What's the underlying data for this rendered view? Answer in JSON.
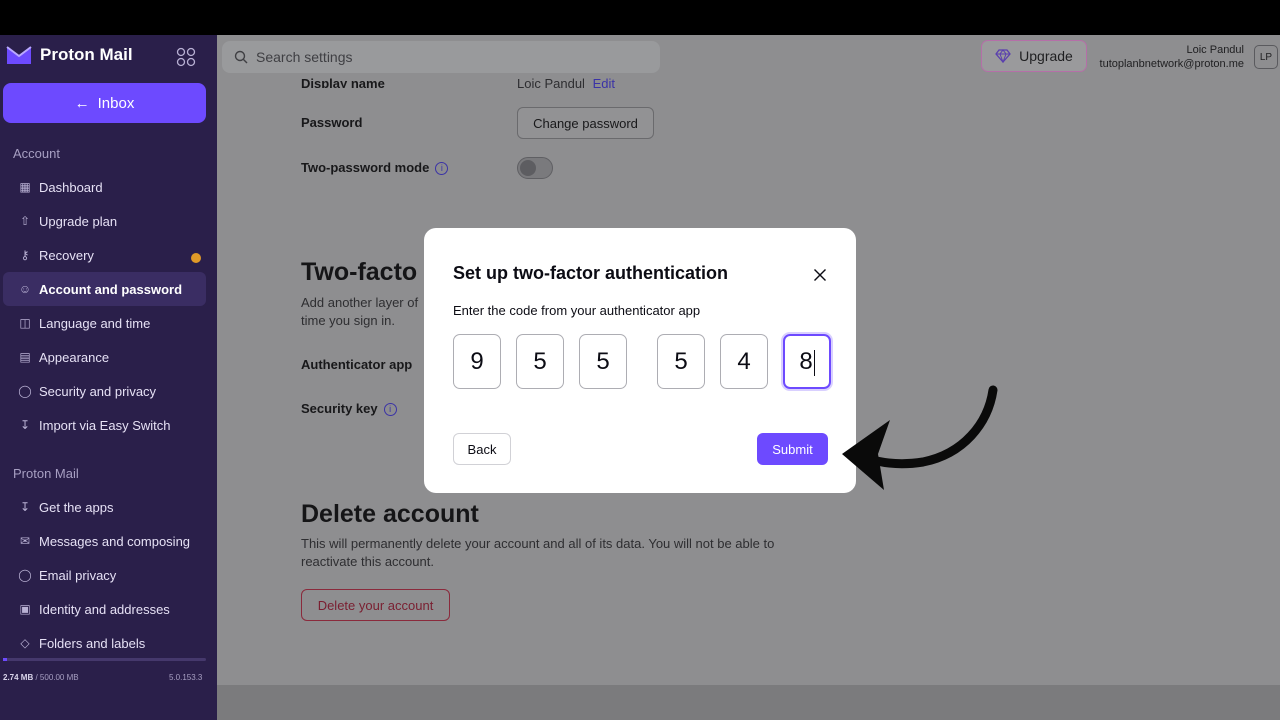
{
  "brand": {
    "name": "Proton Mail"
  },
  "sidebar": {
    "inbox_label": "Inbox",
    "account_section": "Account",
    "account_items": [
      {
        "label": "Dashboard",
        "icon": "dashboard-icon"
      },
      {
        "label": "Upgrade plan",
        "icon": "upgrade-icon"
      },
      {
        "label": "Recovery",
        "icon": "key-icon"
      },
      {
        "label": "Account and password",
        "icon": "user-icon"
      },
      {
        "label": "Language and time",
        "icon": "language-icon"
      },
      {
        "label": "Appearance",
        "icon": "paint-roller-icon"
      },
      {
        "label": "Security and privacy",
        "icon": "shield-icon"
      },
      {
        "label": "Import via Easy Switch",
        "icon": "import-icon"
      }
    ],
    "mail_section": "Proton Mail",
    "mail_items": [
      {
        "label": "Get the apps",
        "icon": "download-icon"
      },
      {
        "label": "Messages and composing",
        "icon": "envelope-icon"
      },
      {
        "label": "Email privacy",
        "icon": "shield-icon"
      },
      {
        "label": "Identity and addresses",
        "icon": "id-card-icon"
      },
      {
        "label": "Folders and labels",
        "icon": "tag-icon"
      }
    ],
    "storage_used": "2.74 MB",
    "storage_total": "/ 500.00 MB",
    "storage_fraction": 0.0055,
    "version": "5.0.153.3"
  },
  "header": {
    "search_placeholder": "Search settings",
    "upgrade_label": "Upgrade",
    "user_name": "Loic Pandul",
    "user_email": "tutoplanbnetwork@proton.me",
    "avatar_initials": "LP"
  },
  "main": {
    "display_name_label": "Display name",
    "display_name_value": "Loic Pandul",
    "edit_link": "Edit",
    "password_label": "Password",
    "change_password_label": "Change password",
    "two_password_label": "Two-password mode",
    "two_factor_heading": "Two-facto",
    "two_factor_desc_1": "Add another layer of",
    "two_factor_desc_2": "time you sign in.",
    "authenticator_label": "Authenticator app",
    "security_key_label": "Security key",
    "delete_heading": "Delete account",
    "delete_desc_1": "This will permanently delete your account and all of its data. You will not be able to",
    "delete_desc_2": "reactivate this account.",
    "delete_button": "Delete your account"
  },
  "modal": {
    "title": "Set up two-factor authentication",
    "subtitle": "Enter the code from your authenticator app",
    "code": [
      "9",
      "5",
      "5",
      "5",
      "4",
      "8"
    ],
    "back_label": "Back",
    "submit_label": "Submit"
  },
  "colors": {
    "accent": "#6d4aff",
    "sidebar_bg": "#2a1f4a",
    "warning_dot": "#e09a28"
  }
}
